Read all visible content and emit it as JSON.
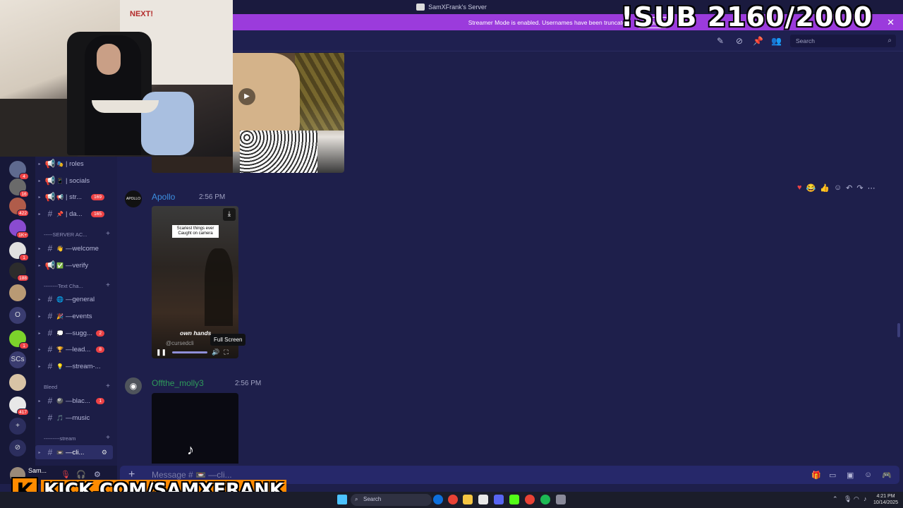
{
  "window": {
    "title": "SamXFrank's Server"
  },
  "banner": {
    "text": "Streamer Mode is enabled. Usernames have been truncated.",
    "disable_label": "Disable"
  },
  "overlay": {
    "sub_text": "!SUB 2160/2000",
    "kick_url": "KICK.COM/SAMXFRANK",
    "kick_letter": "K"
  },
  "header": {
    "search_placeholder": "Search"
  },
  "servers": [
    {
      "label": "",
      "badge": "4",
      "color": "#5f6a8f"
    },
    {
      "label": "",
      "badge": "16",
      "color": "#6a6a6a"
    },
    {
      "label": "",
      "badge": "422",
      "color": "#b05c4a"
    },
    {
      "label": "",
      "badge": "1K+",
      "color": "#8a4bd0"
    },
    {
      "label": "",
      "badge": "1",
      "color": "#e0e0e0"
    },
    {
      "label": "",
      "badge": "188",
      "color": "#2c2c2c"
    },
    {
      "label": "",
      "badge": "",
      "color": "#b99a74"
    },
    {
      "label": "O",
      "badge": "",
      "color": "#3a3c70"
    },
    {
      "label": "",
      "badge": "1",
      "color": "#7cd32b"
    },
    {
      "label": "SCs",
      "badge": "",
      "color": "#3a3c70"
    },
    {
      "label": "",
      "badge": "",
      "color": "#d8c3a5"
    },
    {
      "label": "",
      "badge": "417",
      "color": "#e8e8e8"
    },
    {
      "label": "+",
      "badge": "",
      "color": "#2c2e5e"
    },
    {
      "label": "⊘",
      "badge": "",
      "color": "#2c2e5e"
    }
  ],
  "channels": {
    "items": [
      {
        "name": "| roles",
        "emoji": "🎭",
        "icon": "📢",
        "count": ""
      },
      {
        "name": "| socials",
        "emoji": "📱",
        "icon": "📢",
        "count": ""
      },
      {
        "name": "| str...",
        "emoji": "📢",
        "icon": "📢",
        "count": "169"
      },
      {
        "name": "| da...",
        "emoji": "📌",
        "icon": "#",
        "count": "165"
      },
      {
        "name": "—welcome",
        "emoji": "👋",
        "icon": "#",
        "count": ""
      },
      {
        "name": "—verify",
        "emoji": "✅",
        "icon": "📢",
        "count": ""
      },
      {
        "name": "—general",
        "emoji": "🌐",
        "icon": "#",
        "count": ""
      },
      {
        "name": "—events",
        "emoji": "🎉",
        "icon": "#",
        "count": ""
      },
      {
        "name": "—sugg...",
        "emoji": "💭",
        "icon": "#",
        "count": "2"
      },
      {
        "name": "—lead...",
        "emoji": "🏆",
        "icon": "#",
        "count": "8"
      },
      {
        "name": "—stream-...",
        "emoji": "💡",
        "icon": "#",
        "count": ""
      },
      {
        "name": "—blac...",
        "emoji": "🎱",
        "icon": "#",
        "count": "1"
      },
      {
        "name": "—music",
        "emoji": "🎵",
        "icon": "#",
        "count": ""
      },
      {
        "name": "—cli...",
        "emoji": "📼",
        "icon": "#",
        "count": ""
      }
    ],
    "categories": [
      "-----SERVER AC...",
      "--------Text Cha...",
      "Bleed",
      "---------stream"
    ]
  },
  "messages": [
    {
      "author": "Apollo",
      "time": "2:56 PM",
      "author_color": "#3d8fe0",
      "avatar_text": "APOLLO"
    },
    {
      "author": "Offthe_molly3",
      "time": "2:56 PM",
      "author_color": "#2e9a5a",
      "avatar_text": ""
    }
  ],
  "tiktok": {
    "caption": "Scariest things ever Caught on camera",
    "overlay_text": "own hands",
    "handle": "@cursedcli",
    "tooltip": "Full Screen"
  },
  "composer": {
    "placeholder": "Message # 📼 —cli..."
  },
  "user": {
    "name": "Sam..."
  },
  "taskbar": {
    "search": "Search",
    "time": "4:21 PM",
    "date": "10/14/2025"
  },
  "colors": {
    "accent": "#9b3bdc",
    "bg": "#1e1f4b",
    "badge": "#ed4245",
    "kick": "#ff8a00"
  }
}
